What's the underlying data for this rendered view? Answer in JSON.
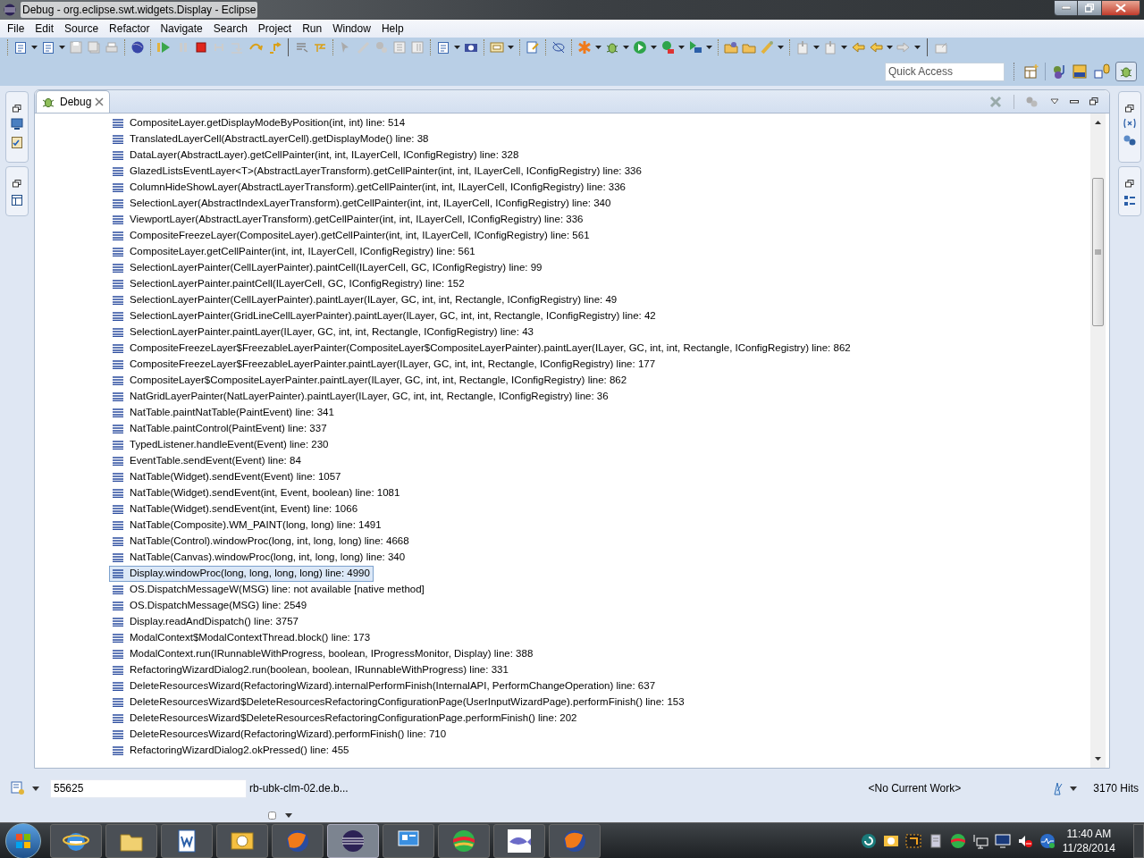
{
  "window": {
    "title": "Debug - org.eclipse.swt.widgets.Display - Eclipse"
  },
  "menu": [
    "File",
    "Edit",
    "Source",
    "Refactor",
    "Navigate",
    "Search",
    "Project",
    "Run",
    "Window",
    "Help"
  ],
  "quick_access": {
    "placeholder": "Quick Access"
  },
  "view": {
    "tab": {
      "label": "Debug",
      "selected": true
    },
    "frames": [
      {
        "text": "CompositeLayer.getDisplayModeByPosition(int, int) line: 514",
        "selected": false
      },
      {
        "text": "TranslatedLayerCell(AbstractLayerCell).getDisplayMode() line: 38",
        "selected": false
      },
      {
        "text": "DataLayer(AbstractLayer).getCellPainter(int, int, ILayerCell, IConfigRegistry) line: 328",
        "selected": false
      },
      {
        "text": "GlazedListsEventLayer<T>(AbstractLayerTransform).getCellPainter(int, int, ILayerCell, IConfigRegistry) line: 336",
        "selected": false
      },
      {
        "text": "ColumnHideShowLayer(AbstractLayerTransform).getCellPainter(int, int, ILayerCell, IConfigRegistry) line: 336",
        "selected": false
      },
      {
        "text": "SelectionLayer(AbstractIndexLayerTransform).getCellPainter(int, int, ILayerCell, IConfigRegistry) line: 340",
        "selected": false
      },
      {
        "text": "ViewportLayer(AbstractLayerTransform).getCellPainter(int, int, ILayerCell, IConfigRegistry) line: 336",
        "selected": false
      },
      {
        "text": "CompositeFreezeLayer(CompositeLayer).getCellPainter(int, int, ILayerCell, IConfigRegistry) line: 561",
        "selected": false
      },
      {
        "text": "CompositeLayer.getCellPainter(int, int, ILayerCell, IConfigRegistry) line: 561",
        "selected": false
      },
      {
        "text": "SelectionLayerPainter(CellLayerPainter).paintCell(ILayerCell, GC, IConfigRegistry) line: 99",
        "selected": false
      },
      {
        "text": "SelectionLayerPainter.paintCell(ILayerCell, GC, IConfigRegistry) line: 152",
        "selected": false
      },
      {
        "text": "SelectionLayerPainter(CellLayerPainter).paintLayer(ILayer, GC, int, int, Rectangle, IConfigRegistry) line: 49",
        "selected": false
      },
      {
        "text": "SelectionLayerPainter(GridLineCellLayerPainter).paintLayer(ILayer, GC, int, int, Rectangle, IConfigRegistry) line: 42",
        "selected": false
      },
      {
        "text": "SelectionLayerPainter.paintLayer(ILayer, GC, int, int, Rectangle, IConfigRegistry) line: 43",
        "selected": false
      },
      {
        "text": "CompositeFreezeLayer$FreezableLayerPainter(CompositeLayer$CompositeLayerPainter).paintLayer(ILayer, GC, int, int, Rectangle, IConfigRegistry) line: 862",
        "selected": false
      },
      {
        "text": "CompositeFreezeLayer$FreezableLayerPainter.paintLayer(ILayer, GC, int, int, Rectangle, IConfigRegistry) line: 177",
        "selected": false
      },
      {
        "text": "CompositeLayer$CompositeLayerPainter.paintLayer(ILayer, GC, int, int, Rectangle, IConfigRegistry) line: 862",
        "selected": false
      },
      {
        "text": "NatGridLayerPainter(NatLayerPainter).paintLayer(ILayer, GC, int, int, Rectangle, IConfigRegistry) line: 36",
        "selected": false
      },
      {
        "text": "NatTable.paintNatTable(PaintEvent) line: 341",
        "selected": false
      },
      {
        "text": "NatTable.paintControl(PaintEvent) line: 337",
        "selected": false
      },
      {
        "text": "TypedListener.handleEvent(Event) line: 230",
        "selected": false
      },
      {
        "text": "EventTable.sendEvent(Event) line: 84",
        "selected": false
      },
      {
        "text": "NatTable(Widget).sendEvent(Event) line: 1057",
        "selected": false
      },
      {
        "text": "NatTable(Widget).sendEvent(int, Event, boolean) line: 1081",
        "selected": false
      },
      {
        "text": "NatTable(Widget).sendEvent(int, Event) line: 1066",
        "selected": false
      },
      {
        "text": "NatTable(Composite).WM_PAINT(long, long) line: 1491",
        "selected": false
      },
      {
        "text": "NatTable(Control).windowProc(long, int, long, long) line: 4668",
        "selected": false
      },
      {
        "text": "NatTable(Canvas).windowProc(long, int, long, long) line: 340",
        "selected": false
      },
      {
        "text": "Display.windowProc(long, long, long, long) line: 4990",
        "selected": true
      },
      {
        "text": "OS.DispatchMessageW(MSG) line: not available [native method]",
        "selected": false
      },
      {
        "text": "OS.DispatchMessage(MSG) line: 2549",
        "selected": false
      },
      {
        "text": "Display.readAndDispatch() line: 3757",
        "selected": false
      },
      {
        "text": "ModalContext$ModalContextThread.block() line: 173",
        "selected": false
      },
      {
        "text": "ModalContext.run(IRunnableWithProgress, boolean, IProgressMonitor, Display) line: 388",
        "selected": false
      },
      {
        "text": "RefactoringWizardDialog2.run(boolean, boolean, IRunnableWithProgress) line: 331",
        "selected": false
      },
      {
        "text": "DeleteResourcesWizard(RefactoringWizard).internalPerformFinish(InternalAPI, PerformChangeOperation) line: 637",
        "selected": false
      },
      {
        "text": "DeleteResourcesWizard$DeleteResourcesRefactoringConfigurationPage(UserInputWizardPage).performFinish() line: 153",
        "selected": false
      },
      {
        "text": "DeleteResourcesWizard$DeleteResourcesRefactoringConfigurationPage.performFinish() line: 202",
        "selected": false
      },
      {
        "text": "DeleteResourcesWizard(RefactoringWizard).performFinish() line: 710",
        "selected": false
      },
      {
        "text": "RefactoringWizardDialog2.okPressed() line: 455",
        "selected": false
      }
    ]
  },
  "status_bar": {
    "task_field": "55625",
    "host": "rb-ubk-clm-02.de.b...",
    "work": "<No Current Work>",
    "hits": "3170 Hits"
  },
  "taskbar": {
    "time": "11:40 AM",
    "date": "11/28/2014"
  }
}
